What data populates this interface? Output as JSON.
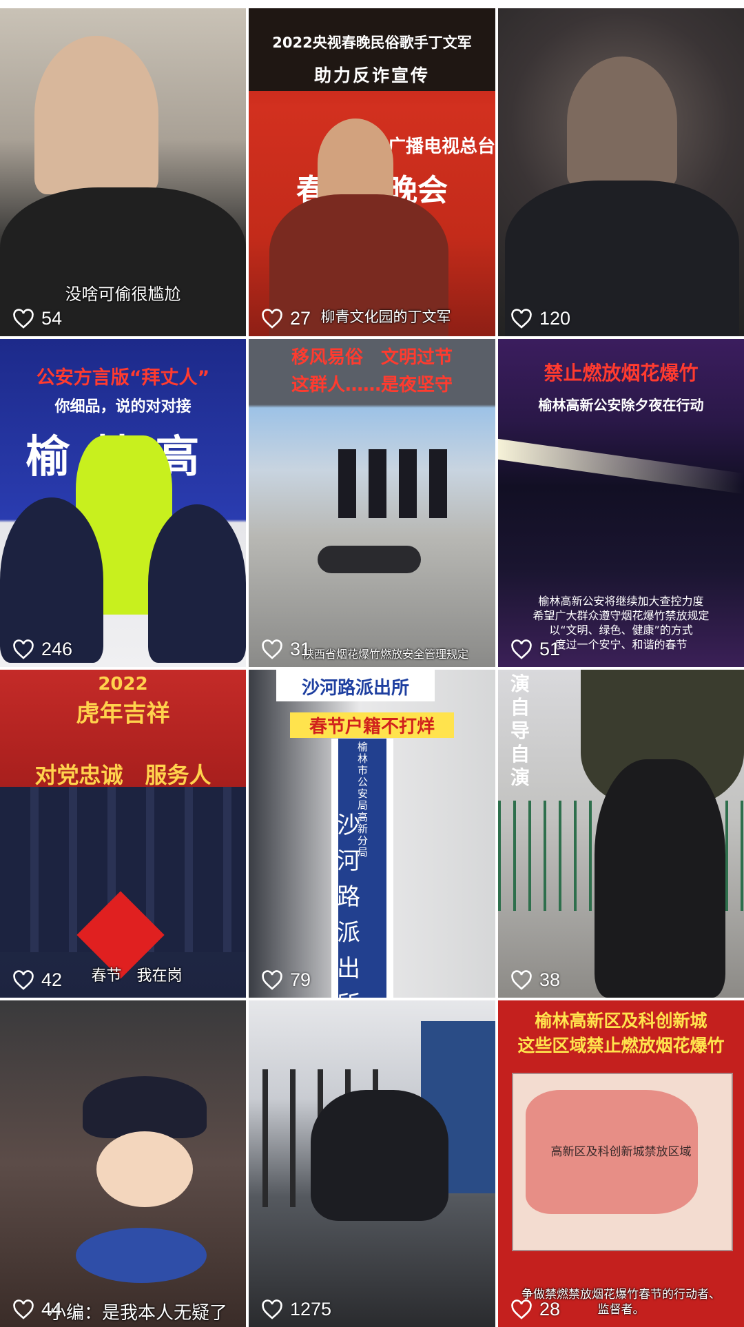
{
  "colors": {
    "heart": "#ffffff",
    "like_text": "#ffffff"
  },
  "icons": {
    "like": "heart-outline-icon"
  },
  "tiles": [
    {
      "likes": "54",
      "caption": "没啥可偷很尴尬",
      "banner_top": "",
      "banner_sub": ""
    },
    {
      "likes": "27",
      "caption": "柳青文化园的丁文军",
      "banner_top": "2022央视春晚民俗歌手丁文军",
      "banner_sub": "助力反诈宣传",
      "overlay_text": "中央广播电视总台",
      "overlay_text2": "春联欢晚会"
    },
    {
      "likes": "120",
      "caption": "",
      "banner_top": "",
      "banner_sub": ""
    },
    {
      "likes": "246",
      "caption": "",
      "banner_top": "公安方言版“拜丈人”",
      "banner_sub": "你细品，说的对对接",
      "overlay_text": "榆林高新"
    },
    {
      "likes": "31",
      "caption": "陕西省烟花爆竹燃放安全管理规定",
      "banner_top": "移风易俗　文明过节",
      "banner_sub": "这群人……是夜坚守"
    },
    {
      "likes": "51",
      "caption": "",
      "banner_top": "禁止燃放烟花爆竹",
      "banner_sub": "榆林高新公安除夕夜在行动",
      "notice": [
        "榆林高新公安将继续加大查控力度",
        "希望广大群众遵守烟花爆竹禁放规定",
        "以“文明、绿色、健康”的方式",
        "度过一个安宁、和谐的春节"
      ]
    },
    {
      "likes": "42",
      "caption": "春节　我在岗",
      "banner_top": "2022",
      "banner_sub": "虎年吉祥",
      "overlay_text": "对党忠诚　服务人"
    },
    {
      "likes": "79",
      "caption": "",
      "banner_top": "沙河路派出所",
      "banner_sub": "春节户籍不打烊",
      "sign_small": "榆林市公安局高新分局",
      "sign_big": "沙河路派出所"
    },
    {
      "likes": "38",
      "caption": "",
      "banner_top": "演自导自演",
      "banner_sub": ""
    },
    {
      "likes": "44",
      "caption": "小编：是我本人无疑了",
      "banner_top": "",
      "banner_sub": ""
    },
    {
      "likes": "1275",
      "caption": "",
      "banner_top": "",
      "banner_sub": ""
    },
    {
      "likes": "28",
      "caption": "争做禁燃禁放烟花爆竹春节的行动者、监督者。",
      "banner_top": "榆林高新区及科创新城",
      "banner_sub": "这些区域禁止燃放烟花爆竹",
      "map_label": "高新区及科创新城禁放区域"
    }
  ]
}
